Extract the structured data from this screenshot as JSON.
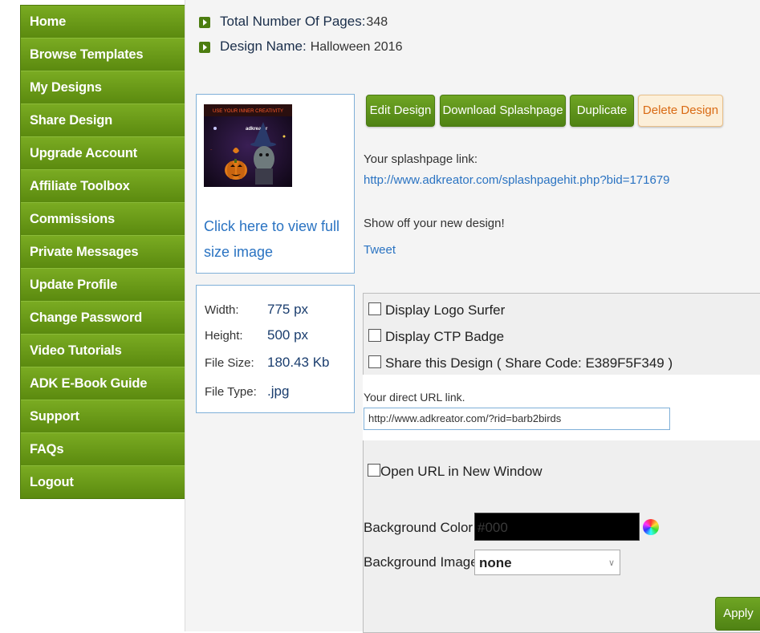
{
  "sidebar": {
    "items": [
      {
        "label": "Home"
      },
      {
        "label": "Browse Templates"
      },
      {
        "label": "My Designs"
      },
      {
        "label": "Share Design"
      },
      {
        "label": "Upgrade Account"
      },
      {
        "label": "Affiliate Toolbox"
      },
      {
        "label": "Commissions"
      },
      {
        "label": "Private Messages"
      },
      {
        "label": "Update Profile"
      },
      {
        "label": "Change Password"
      },
      {
        "label": "Video Tutorials"
      },
      {
        "label": "ADK E-Book Guide"
      },
      {
        "label": "Support"
      },
      {
        "label": "FAQs"
      },
      {
        "label": "Logout"
      }
    ]
  },
  "summary": {
    "pages_label": "Total Number Of Pages:",
    "pages_value": "348",
    "design_label": "Design Name:",
    "design_value": "Halloween 2016"
  },
  "preview": {
    "thumb_caption": "USE YOUR INNER CREATIVITY",
    "thumb_brand": "adkreator",
    "view_full_link": "Click here to view full size image"
  },
  "image_meta": {
    "width_label": "Width:",
    "width_value": "775 px",
    "height_label": "Height:",
    "height_value": "500 px",
    "size_label": "File Size:",
    "size_value": "180.43 Kb",
    "type_label": "File Type:",
    "type_value": ".jpg"
  },
  "actions": {
    "edit": "Edit Design",
    "download": "Download Splashpage",
    "duplicate": "Duplicate",
    "delete": "Delete Design"
  },
  "splash": {
    "label": "Your splashpage link:",
    "url": "http://www.adkreator.com/splashpagehit.php?bid=171679",
    "show_off": "Show off your new design!",
    "tweet": "Tweet"
  },
  "options": {
    "logo_surfer": "Display Logo Surfer",
    "ctp_badge": "Display CTP Badge",
    "share": "Share this Design ( Share Code: E389F5F349 )",
    "direct_url_label": "Your direct URL link.",
    "direct_url_value": "http://www.adkreator.com/?rid=barb2birds",
    "new_window": "Open URL in New Window",
    "bg_color_label": "Background Color",
    "bg_color_value": "#000",
    "bg_image_label": "Background Image",
    "bg_image_value": "none",
    "apply": "Apply"
  },
  "colors": {
    "nav_green": "#6a9a18",
    "link_blue": "#2a73c2",
    "delete_orange": "#d96a14"
  }
}
